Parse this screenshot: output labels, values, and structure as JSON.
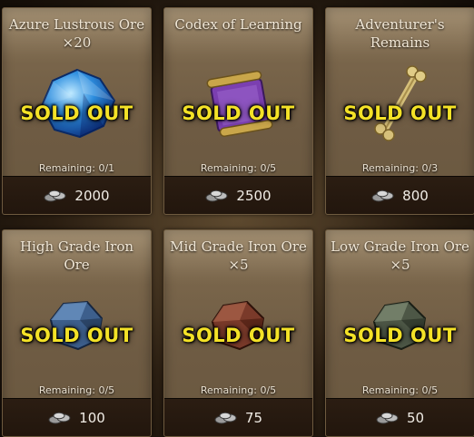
{
  "items": [
    {
      "title": "Azure Lustrous Ore ×20",
      "status": "SOLD OUT",
      "remaining": "Remaining: 0/1",
      "price": "2000",
      "icon": "azure-ore-icon"
    },
    {
      "title": "Codex of Learning",
      "status": "SOLD OUT",
      "remaining": "Remaining: 0/5",
      "price": "2500",
      "icon": "scroll-icon"
    },
    {
      "title": "Adventurer's Remains",
      "status": "SOLD OUT",
      "remaining": "Remaining: 0/3",
      "price": "800",
      "icon": "bone-icon"
    },
    {
      "title": "High Grade Iron Ore",
      "status": "SOLD OUT",
      "remaining": "Remaining: 0/5",
      "price": "100",
      "icon": "high-grade-ore-icon"
    },
    {
      "title": "Mid Grade Iron Ore ×5",
      "status": "SOLD OUT",
      "remaining": "Remaining: 0/5",
      "price": "75",
      "icon": "mid-grade-ore-icon"
    },
    {
      "title": "Low Grade Iron Ore ×5",
      "status": "SOLD OUT",
      "remaining": "Remaining: 0/5",
      "price": "50",
      "icon": "low-grade-ore-icon"
    }
  ],
  "currency_icon": "coins-icon"
}
